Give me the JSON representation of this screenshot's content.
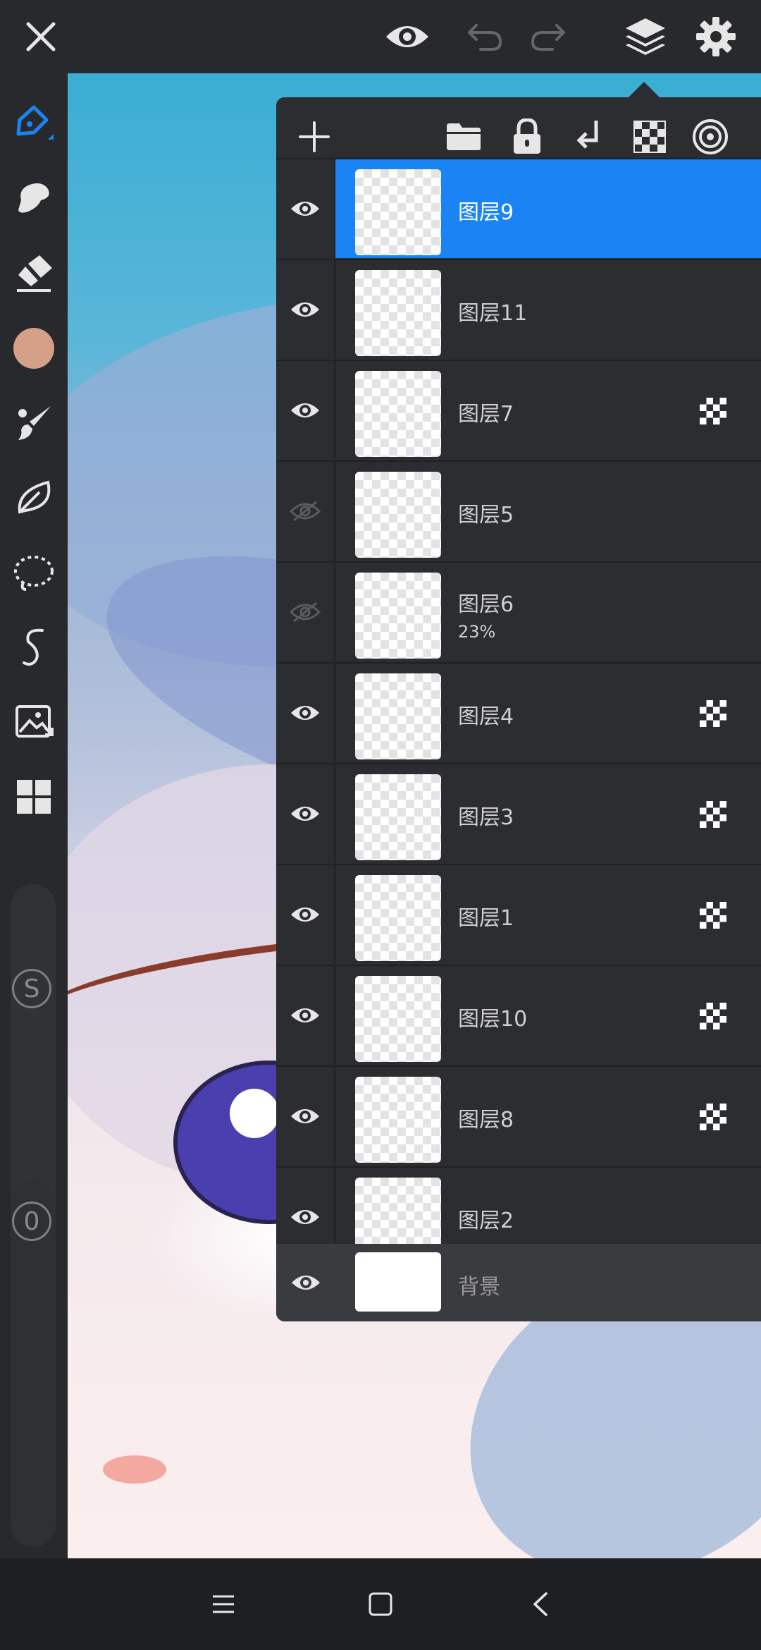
{
  "layers": [
    {
      "name": "图层9",
      "visible": true,
      "selected": true,
      "clip": false
    },
    {
      "name": "图层11",
      "visible": true,
      "clip": false
    },
    {
      "name": "图层7",
      "visible": true,
      "clip": true
    },
    {
      "name": "图层5",
      "visible": false,
      "clip": false
    },
    {
      "name": "图层6",
      "visible": false,
      "opacity": "23%",
      "clip": false
    },
    {
      "name": "图层4",
      "visible": true,
      "clip": true
    },
    {
      "name": "图层3",
      "visible": true,
      "clip": true
    },
    {
      "name": "图层1",
      "visible": true,
      "clip": true
    },
    {
      "name": "图层10",
      "visible": true,
      "clip": true
    },
    {
      "name": "图层8",
      "visible": true,
      "clip": true
    },
    {
      "name": "图层2",
      "visible": true,
      "clip": false
    }
  ],
  "background_layer": {
    "name": "背景",
    "visible": true
  },
  "sliders": {
    "size_label": "S",
    "opacity_label": "0"
  },
  "colors": {
    "accent": "#1a84f4",
    "current_color": "#d4a088",
    "panel": "#2b2d30",
    "toolbar": "#27292c"
  },
  "icons": {
    "top": [
      "close-icon",
      "eye-icon",
      "undo-icon",
      "redo-icon",
      "layers-icon",
      "settings-icon"
    ],
    "left": [
      "pen-icon",
      "smudge-icon",
      "eraser-icon",
      "color-swatch",
      "brush-icon",
      "leaf-icon",
      "lasso-icon",
      "curve-icon",
      "image-import-icon",
      "grid-icon"
    ],
    "panel": [
      "add-icon",
      "folder-icon",
      "lock-icon",
      "merge-down-icon",
      "checker-icon",
      "target-icon"
    ],
    "nav": [
      "menu-icon",
      "home-icon",
      "back-icon"
    ]
  }
}
